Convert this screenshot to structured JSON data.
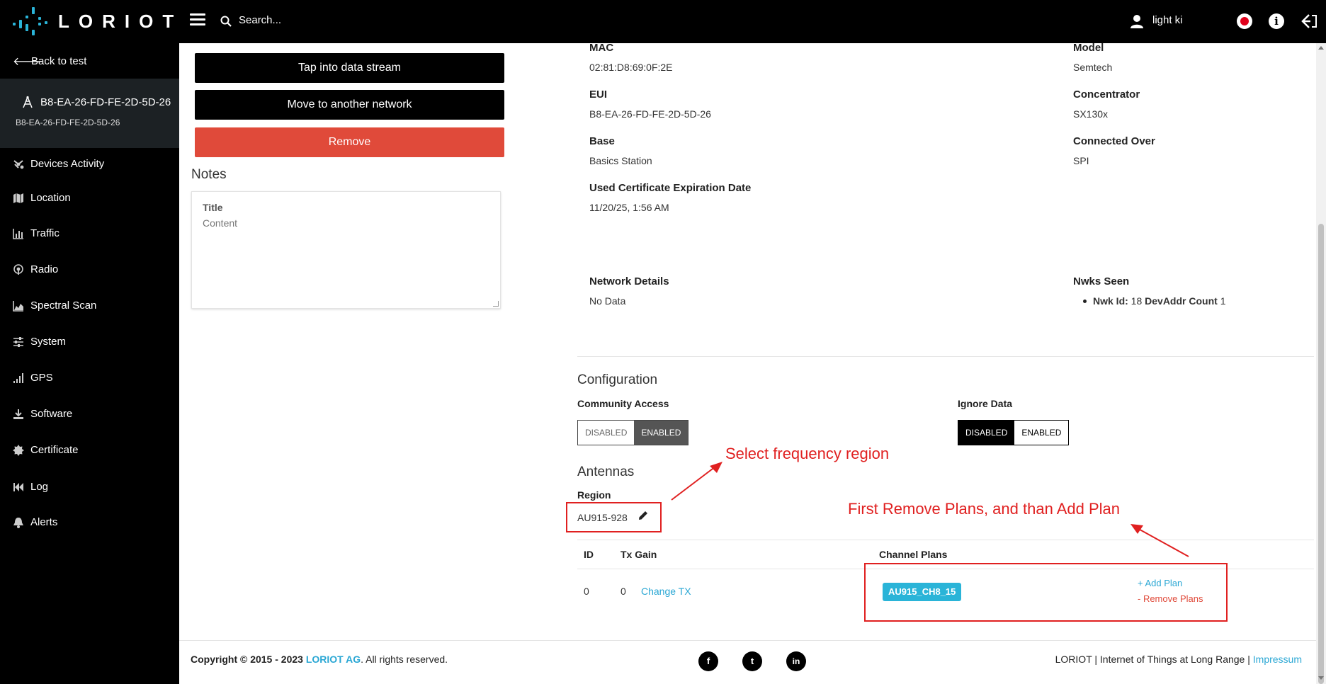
{
  "topbar": {
    "logo_text": "LORIOT",
    "search_label": "Search...",
    "user_name": "light ki",
    "info_glyph": "i"
  },
  "sidebar": {
    "back_label": "Back to test",
    "gateway_title": "B8-EA-26-FD-FE-2D-5D-26",
    "gateway_sub": "B8-EA-26-FD-FE-2D-5D-26",
    "items": [
      {
        "label": "Devices Activity",
        "icon": "devices-icon"
      },
      {
        "label": "Location",
        "icon": "map-icon"
      },
      {
        "label": "Traffic",
        "icon": "bar-chart-icon"
      },
      {
        "label": "Radio",
        "icon": "radio-icon"
      },
      {
        "label": "Spectral Scan",
        "icon": "area-chart-icon"
      },
      {
        "label": "System",
        "icon": "sliders-icon"
      },
      {
        "label": "GPS",
        "icon": "signal-icon"
      },
      {
        "label": "Software",
        "icon": "download-icon"
      },
      {
        "label": "Certificate",
        "icon": "certificate-icon"
      },
      {
        "label": "Log",
        "icon": "rewind-icon"
      },
      {
        "label": "Alerts",
        "icon": "bell-icon"
      }
    ]
  },
  "actions": {
    "tap_label": "Tap into data stream",
    "move_label": "Move to another network",
    "remove_label": "Remove"
  },
  "notes": {
    "heading": "Notes",
    "title_placeholder": "Title",
    "content_placeholder": "Content"
  },
  "details": {
    "mac_label": "MAC",
    "mac_value": "02:81:D8:69:0F:2E",
    "model_label": "Model",
    "model_value": "Semtech",
    "eui_label": "EUI",
    "eui_value": "B8-EA-26-FD-FE-2D-5D-26",
    "concentrator_label": "Concentrator",
    "concentrator_value": "SX130x",
    "base_label": "Base",
    "base_value": "Basics Station",
    "connected_label": "Connected Over",
    "connected_value": "SPI",
    "cert_label": "Used Certificate Expiration Date",
    "cert_value": "11/20/25, 1:56 AM",
    "network_label": "Network Details",
    "network_value": "No Data",
    "nwks_label": "Nwks Seen",
    "nwk_id_label": "Nwk Id:",
    "nwk_id_value": "18",
    "devaddr_label": "DevAddr Count",
    "devaddr_value": "1"
  },
  "configuration": {
    "heading": "Configuration",
    "community_label": "Community Access",
    "community_off": "DISABLED",
    "community_on": "ENABLED",
    "community_selected": "ENABLED",
    "ignore_label": "Ignore Data",
    "ignore_off": "DISABLED",
    "ignore_on": "ENABLED",
    "ignore_selected": "DISABLED"
  },
  "antennas": {
    "heading": "Antennas",
    "region_label": "Region",
    "region_value": "AU915-928",
    "columns": [
      "ID",
      "Tx Gain",
      "Channel Plans"
    ],
    "row": {
      "id": "0",
      "tx_gain": "0",
      "change_tx": "Change TX",
      "channel_plan": "AU915_CH8_15",
      "add_plan": "+ Add Plan",
      "remove_plans": "- Remove Plans"
    }
  },
  "annotations": {
    "region_note": "Select frequency region",
    "plans_note": "First Remove Plans, and than Add Plan"
  },
  "footer": {
    "copyright_bold": "Copyright © 2015 - 2023",
    "company": "LORIOT AG",
    "rights": ". All rights reserved.",
    "social": [
      "f",
      "t",
      "in"
    ],
    "right_text": "LORIOT | Internet of Things at Long Range |",
    "impressum": "Impressum"
  },
  "colors": {
    "accent": "#2ab4d8",
    "danger": "#e04a3a",
    "annotation": "#e02020",
    "sidebar_bg": "#000000"
  }
}
